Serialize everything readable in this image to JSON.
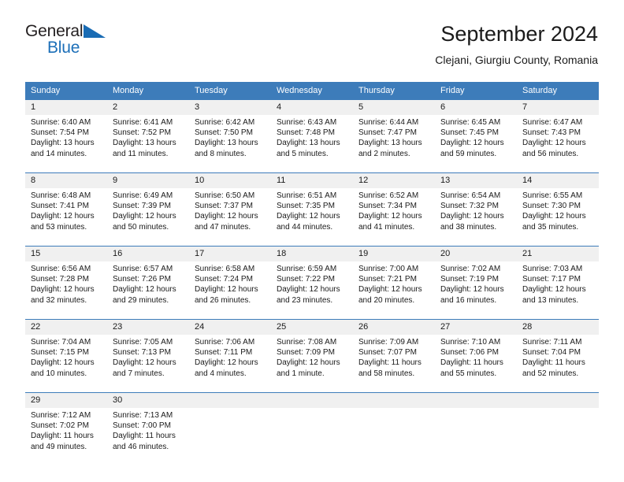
{
  "brand": {
    "name_top": "General",
    "name_bottom": "Blue",
    "triangle_icon": "triangle-icon",
    "accent_color": "#1a6cb4"
  },
  "header": {
    "title": "September 2024",
    "subtitle": "Clejani, Giurgiu County, Romania"
  },
  "calendar": {
    "header_bg": "#3d7cba",
    "daynum_bg": "#f0f0f0",
    "weekdays": [
      "Sunday",
      "Monday",
      "Tuesday",
      "Wednesday",
      "Thursday",
      "Friday",
      "Saturday"
    ],
    "weeks": [
      [
        {
          "day": "1",
          "sunrise": "Sunrise: 6:40 AM",
          "sunset": "Sunset: 7:54 PM",
          "daylight": "Daylight: 13 hours and 14 minutes."
        },
        {
          "day": "2",
          "sunrise": "Sunrise: 6:41 AM",
          "sunset": "Sunset: 7:52 PM",
          "daylight": "Daylight: 13 hours and 11 minutes."
        },
        {
          "day": "3",
          "sunrise": "Sunrise: 6:42 AM",
          "sunset": "Sunset: 7:50 PM",
          "daylight": "Daylight: 13 hours and 8 minutes."
        },
        {
          "day": "4",
          "sunrise": "Sunrise: 6:43 AM",
          "sunset": "Sunset: 7:48 PM",
          "daylight": "Daylight: 13 hours and 5 minutes."
        },
        {
          "day": "5",
          "sunrise": "Sunrise: 6:44 AM",
          "sunset": "Sunset: 7:47 PM",
          "daylight": "Daylight: 13 hours and 2 minutes."
        },
        {
          "day": "6",
          "sunrise": "Sunrise: 6:45 AM",
          "sunset": "Sunset: 7:45 PM",
          "daylight": "Daylight: 12 hours and 59 minutes."
        },
        {
          "day": "7",
          "sunrise": "Sunrise: 6:47 AM",
          "sunset": "Sunset: 7:43 PM",
          "daylight": "Daylight: 12 hours and 56 minutes."
        }
      ],
      [
        {
          "day": "8",
          "sunrise": "Sunrise: 6:48 AM",
          "sunset": "Sunset: 7:41 PM",
          "daylight": "Daylight: 12 hours and 53 minutes."
        },
        {
          "day": "9",
          "sunrise": "Sunrise: 6:49 AM",
          "sunset": "Sunset: 7:39 PM",
          "daylight": "Daylight: 12 hours and 50 minutes."
        },
        {
          "day": "10",
          "sunrise": "Sunrise: 6:50 AM",
          "sunset": "Sunset: 7:37 PM",
          "daylight": "Daylight: 12 hours and 47 minutes."
        },
        {
          "day": "11",
          "sunrise": "Sunrise: 6:51 AM",
          "sunset": "Sunset: 7:35 PM",
          "daylight": "Daylight: 12 hours and 44 minutes."
        },
        {
          "day": "12",
          "sunrise": "Sunrise: 6:52 AM",
          "sunset": "Sunset: 7:34 PM",
          "daylight": "Daylight: 12 hours and 41 minutes."
        },
        {
          "day": "13",
          "sunrise": "Sunrise: 6:54 AM",
          "sunset": "Sunset: 7:32 PM",
          "daylight": "Daylight: 12 hours and 38 minutes."
        },
        {
          "day": "14",
          "sunrise": "Sunrise: 6:55 AM",
          "sunset": "Sunset: 7:30 PM",
          "daylight": "Daylight: 12 hours and 35 minutes."
        }
      ],
      [
        {
          "day": "15",
          "sunrise": "Sunrise: 6:56 AM",
          "sunset": "Sunset: 7:28 PM",
          "daylight": "Daylight: 12 hours and 32 minutes."
        },
        {
          "day": "16",
          "sunrise": "Sunrise: 6:57 AM",
          "sunset": "Sunset: 7:26 PM",
          "daylight": "Daylight: 12 hours and 29 minutes."
        },
        {
          "day": "17",
          "sunrise": "Sunrise: 6:58 AM",
          "sunset": "Sunset: 7:24 PM",
          "daylight": "Daylight: 12 hours and 26 minutes."
        },
        {
          "day": "18",
          "sunrise": "Sunrise: 6:59 AM",
          "sunset": "Sunset: 7:22 PM",
          "daylight": "Daylight: 12 hours and 23 minutes."
        },
        {
          "day": "19",
          "sunrise": "Sunrise: 7:00 AM",
          "sunset": "Sunset: 7:21 PM",
          "daylight": "Daylight: 12 hours and 20 minutes."
        },
        {
          "day": "20",
          "sunrise": "Sunrise: 7:02 AM",
          "sunset": "Sunset: 7:19 PM",
          "daylight": "Daylight: 12 hours and 16 minutes."
        },
        {
          "day": "21",
          "sunrise": "Sunrise: 7:03 AM",
          "sunset": "Sunset: 7:17 PM",
          "daylight": "Daylight: 12 hours and 13 minutes."
        }
      ],
      [
        {
          "day": "22",
          "sunrise": "Sunrise: 7:04 AM",
          "sunset": "Sunset: 7:15 PM",
          "daylight": "Daylight: 12 hours and 10 minutes."
        },
        {
          "day": "23",
          "sunrise": "Sunrise: 7:05 AM",
          "sunset": "Sunset: 7:13 PM",
          "daylight": "Daylight: 12 hours and 7 minutes."
        },
        {
          "day": "24",
          "sunrise": "Sunrise: 7:06 AM",
          "sunset": "Sunset: 7:11 PM",
          "daylight": "Daylight: 12 hours and 4 minutes."
        },
        {
          "day": "25",
          "sunrise": "Sunrise: 7:08 AM",
          "sunset": "Sunset: 7:09 PM",
          "daylight": "Daylight: 12 hours and 1 minute."
        },
        {
          "day": "26",
          "sunrise": "Sunrise: 7:09 AM",
          "sunset": "Sunset: 7:07 PM",
          "daylight": "Daylight: 11 hours and 58 minutes."
        },
        {
          "day": "27",
          "sunrise": "Sunrise: 7:10 AM",
          "sunset": "Sunset: 7:06 PM",
          "daylight": "Daylight: 11 hours and 55 minutes."
        },
        {
          "day": "28",
          "sunrise": "Sunrise: 7:11 AM",
          "sunset": "Sunset: 7:04 PM",
          "daylight": "Daylight: 11 hours and 52 minutes."
        }
      ],
      [
        {
          "day": "29",
          "sunrise": "Sunrise: 7:12 AM",
          "sunset": "Sunset: 7:02 PM",
          "daylight": "Daylight: 11 hours and 49 minutes."
        },
        {
          "day": "30",
          "sunrise": "Sunrise: 7:13 AM",
          "sunset": "Sunset: 7:00 PM",
          "daylight": "Daylight: 11 hours and 46 minutes."
        },
        {
          "day": "",
          "sunrise": "",
          "sunset": "",
          "daylight": ""
        },
        {
          "day": "",
          "sunrise": "",
          "sunset": "",
          "daylight": ""
        },
        {
          "day": "",
          "sunrise": "",
          "sunset": "",
          "daylight": ""
        },
        {
          "day": "",
          "sunrise": "",
          "sunset": "",
          "daylight": ""
        },
        {
          "day": "",
          "sunrise": "",
          "sunset": "",
          "daylight": ""
        }
      ]
    ]
  }
}
